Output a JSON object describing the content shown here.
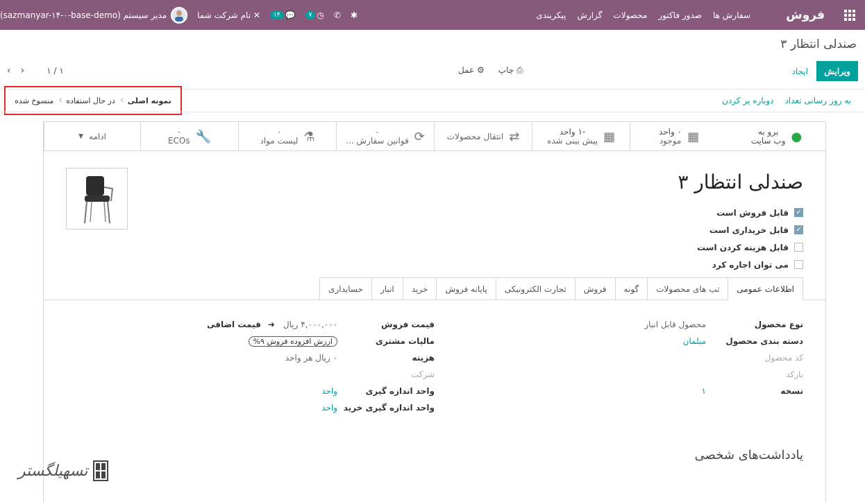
{
  "topbar": {
    "brand": "فروش",
    "menu": [
      "سفارش ها",
      "صدور فاکتور",
      "محصولات",
      "گزارش",
      "پیکربندی"
    ],
    "db_name": "(sazmanyar-۱۴-۰-base-demo)",
    "user_name": "مدیر سیستم",
    "company_name": "نام شرکت شما",
    "activity_count": "۷",
    "message_count": "۱۴",
    "colors": {
      "bar": "#875a7b",
      "badge": "#00a09d"
    }
  },
  "control_panel": {
    "title": "صندلی انتظار ۳",
    "edit_label": "ویرایش",
    "create_label": "ایجاد",
    "print_label": "چاپ",
    "action_label": "عمل",
    "pager": "۱ / ۱"
  },
  "status": {
    "actions": [
      "به روز رسانی تعداد",
      "دوباره پر کردن"
    ],
    "stages": [
      "نمونه اصلی",
      "در حال استفاده",
      "منسوخ شده"
    ]
  },
  "smart_buttons": {
    "website": {
      "line1": "برو به",
      "line2": "وب سایت"
    },
    "onhand": {
      "value": "۰ واحد",
      "label": "موجود"
    },
    "forecast": {
      "value": "-۱ واحد",
      "label": "پیش بینی شده"
    },
    "moves": {
      "label": "انتقال محصولات"
    },
    "reorder": {
      "value": "۰",
      "label": "قوانین سفارش ..."
    },
    "bom": {
      "value": "۰",
      "label": "لیست مواد"
    },
    "ecos": {
      "value": "۰",
      "label": "ECOs"
    },
    "more": {
      "label": "ادامه"
    }
  },
  "product": {
    "name": "صندلی انتظار ۳",
    "checks": [
      {
        "label": "قابل فروش است",
        "checked": true
      },
      {
        "label": "قابل خریداری است",
        "checked": true
      },
      {
        "label": "قابل هزینه کردن است",
        "checked": false
      },
      {
        "label": "می توان اجاره کرد",
        "checked": false
      }
    ]
  },
  "tabs": [
    "اطلاعات عمومی",
    "تب های محصولات",
    "گونه",
    "فروش",
    "تجارت الکترونیکی",
    "پایانه فروش",
    "خرید",
    "انبار",
    "حسابداری"
  ],
  "general": {
    "right": {
      "product_type": {
        "label": "نوع محصول",
        "value": "محصول قابل انبار"
      },
      "category": {
        "label": "دسته بندی محصول",
        "value": "مبلمان"
      },
      "ref": {
        "label": "کد محصول",
        "value": ""
      },
      "barcode": {
        "label": "بارکد",
        "value": ""
      },
      "version": {
        "label": "نسخه",
        "value": "۱"
      }
    },
    "left": {
      "sale_price": {
        "label": "قیمت فروش",
        "value": "۴,۰۰۰,۰۰۰ ریال",
        "extra": "قیمت اضافی"
      },
      "customer_tax": {
        "label": "مالیات مشتری",
        "value": "ارزش افزوده فروش ۹%"
      },
      "cost": {
        "label": "هزینه",
        "value": "۰ ریال هر واحد"
      },
      "company": {
        "label": "شرکت",
        "value": ""
      },
      "uom": {
        "label": "واحد اندازه گیری",
        "value": "واحد"
      },
      "purchase_uom": {
        "label": "واحد اندازه گیری خرید",
        "value": "واحد"
      }
    }
  },
  "notes_title": "یادداشت‌های شخصی",
  "watermark": "تسهیلگستر"
}
